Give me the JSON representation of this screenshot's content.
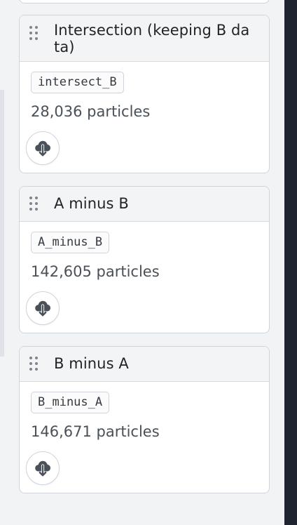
{
  "cards": [
    {
      "title": "Intersection (keeping B data)",
      "dataset_name": "intersect_B",
      "particle_count": "28,036 particles",
      "download_icon": "cloud-download-icon"
    },
    {
      "title": "A minus B",
      "dataset_name": "A_minus_B",
      "particle_count": "142,605 particles",
      "download_icon": "cloud-download-icon"
    },
    {
      "title": "B minus A",
      "dataset_name": "B_minus_A",
      "particle_count": "146,671 particles",
      "download_icon": "cloud-download-icon"
    }
  ],
  "colors": {
    "panel_background": "#f2f3f5",
    "card_background": "#ffffff",
    "header_background": "#f3f4f6",
    "border": "#cfd4da",
    "dark_edge": "#1f2430",
    "icon": "#4a5058"
  }
}
